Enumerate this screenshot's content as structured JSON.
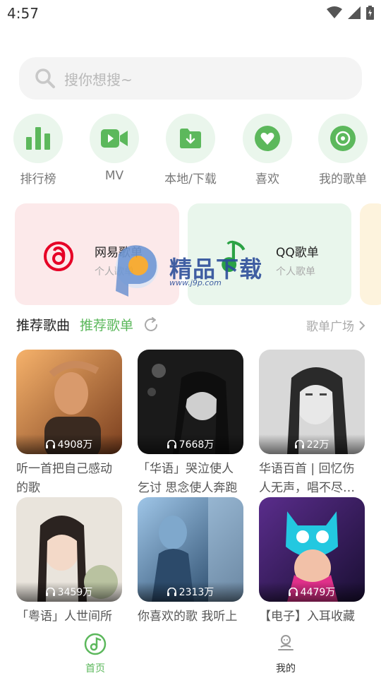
{
  "status_bar": {
    "time": "4:57"
  },
  "search": {
    "placeholder": "搜你想搜~"
  },
  "quick_nav": [
    {
      "label": "排行榜",
      "icon": "bar-chart-icon"
    },
    {
      "label": "MV",
      "icon": "video-camera-icon"
    },
    {
      "label": "本地/下载",
      "icon": "folder-download-icon"
    },
    {
      "label": "喜欢",
      "icon": "heart-icon"
    },
    {
      "label": "我的歌单",
      "icon": "disc-icon"
    }
  ],
  "cards": [
    {
      "title": "网易歌单",
      "subtitle": "个人歌单",
      "icon": "netease-music-icon"
    },
    {
      "title": "QQ歌单",
      "subtitle": "个人歌单",
      "icon": "qq-music-icon"
    }
  ],
  "watermark": {
    "text": "精品下载",
    "url": "www.j9p.com"
  },
  "section": {
    "tab_songs": "推荐歌曲",
    "tab_playlists": "推荐歌单",
    "square_link": "歌单广场"
  },
  "playlists": [
    {
      "title": "听一首把自己感动的歌",
      "plays": "4908万"
    },
    {
      "title": "「华语」哭泣使人乞讨 思念使人奔跑",
      "plays": "7668万"
    },
    {
      "title": "华语百首 | 回忆伤人无声，唱不尽…",
      "plays": "22万"
    },
    {
      "title": "「粤语」人世间所",
      "plays": "3459万"
    },
    {
      "title": "你喜欢的歌 我听上",
      "plays": "2313万"
    },
    {
      "title": "【电子】入耳收藏",
      "plays": "4479万"
    }
  ],
  "bottom_nav": [
    {
      "label": "首页",
      "icon": "music-note-disc-icon"
    },
    {
      "label": "我的",
      "icon": "user-profile-icon"
    }
  ],
  "colors": {
    "accent": "#5cb85c",
    "accent_light": "#eaf6ec",
    "netease_red": "#e60026",
    "netease_card": "#fce9ea",
    "qq_card": "#e9f6ec"
  }
}
